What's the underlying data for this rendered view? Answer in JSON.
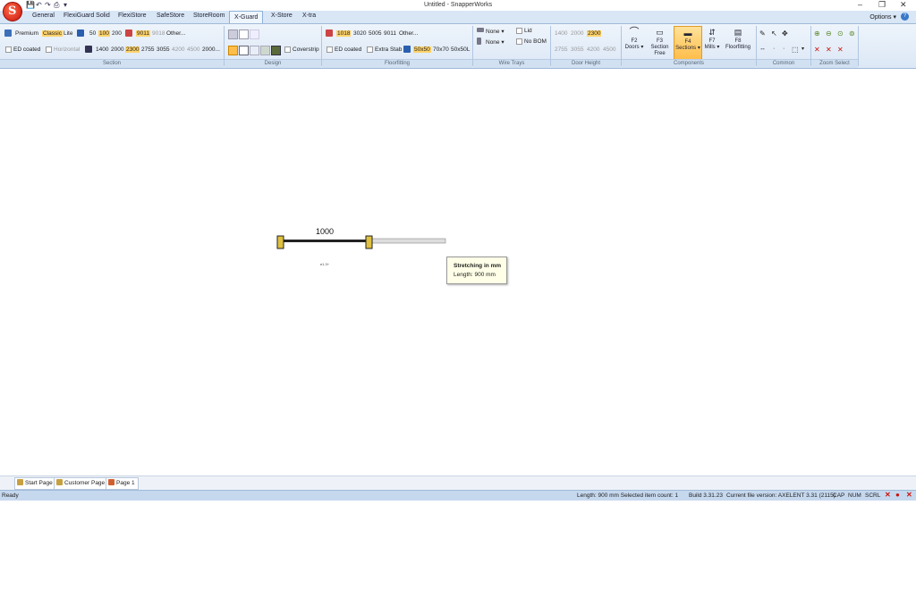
{
  "window": {
    "title": "Untitled - SnapperWorks",
    "controls": [
      "–",
      "❐",
      "✕"
    ]
  },
  "tabs": [
    "General",
    "FlexiGuard Solid",
    "FlexiStore",
    "SafeStore",
    "StoreRoom",
    "X-Guard",
    "X-Store",
    "X-tra"
  ],
  "options_label": "Options",
  "help_label": "?",
  "ribbon": {
    "section": {
      "label": "Section",
      "row1": {
        "premium": "Premium",
        "classic": "Classic",
        "lite": "Lite",
        "h50": "50",
        "h100": "100",
        "h200": "200",
        "c9011": "9011",
        "c9018": "9018",
        "other": "Other..."
      },
      "row2": {
        "ed_coated": "ED coated",
        "horizontal": "Horizontal",
        "l1400": "1400",
        "l2000": "2000",
        "l2300": "2300",
        "l2755": "2755",
        "l3055": "3055",
        "l4200": "4200",
        "l4500": "4500",
        "l2000b": "2000..."
      }
    },
    "design": {
      "label": "Design",
      "coverstrip": "Coverstrip"
    },
    "floorfitting": {
      "label": "Floorfitting",
      "row1": {
        "c1018": "1018",
        "c3020": "3020",
        "c5005": "5005",
        "c9011": "9011",
        "other": "Other..."
      },
      "row2": {
        "ed_coated": "ED coated",
        "extra_stab": "Extra Stab",
        "s50": "50x50",
        "s70": "70x70",
        "s50l": "50x50L"
      }
    },
    "wire_trays": {
      "label": "Wire Trays",
      "none1": "None",
      "none2": "None",
      "lid": "Lid",
      "no_bom": "No BOM"
    },
    "door_height": {
      "label": "Door Height",
      "row1": [
        "1400",
        "2000",
        "2300"
      ],
      "row2": [
        "2755",
        "3055",
        "4200",
        "4500"
      ]
    },
    "components": {
      "label": "Components",
      "buttons": [
        {
          "line1": "F2",
          "line2": "Doors"
        },
        {
          "line1": "F3 Section",
          "line2": "Free"
        },
        {
          "line1": "F4",
          "line2": "Sections"
        },
        {
          "line1": "F7",
          "line2": "Mills"
        },
        {
          "line1": "F8",
          "line2": "Floorfitting"
        }
      ]
    },
    "common": {
      "label": "Common"
    },
    "zoom_select": {
      "label": "Zoom Select"
    }
  },
  "canvas": {
    "dimension_label": "1000",
    "small_label": "e1.3+"
  },
  "tooltip": {
    "title": "Stretching in mm",
    "body": "Length: 900 mm"
  },
  "page_tabs": [
    "Start Page",
    "Customer Page",
    "Page 1"
  ],
  "status": {
    "ready": "Ready",
    "info": "Length: 900 mm Selected item count: 1",
    "build": "Build 3.31.23",
    "file_version": "Current file version: AXELENT 3.31 (2115)",
    "cap": "CAP",
    "num": "NUM",
    "scrl": "SCRL"
  },
  "colors": {
    "accent": "#ffbd49",
    "ribbon": "#dce8f6",
    "status": "#c6d8ee",
    "brand": "#c8140c"
  }
}
